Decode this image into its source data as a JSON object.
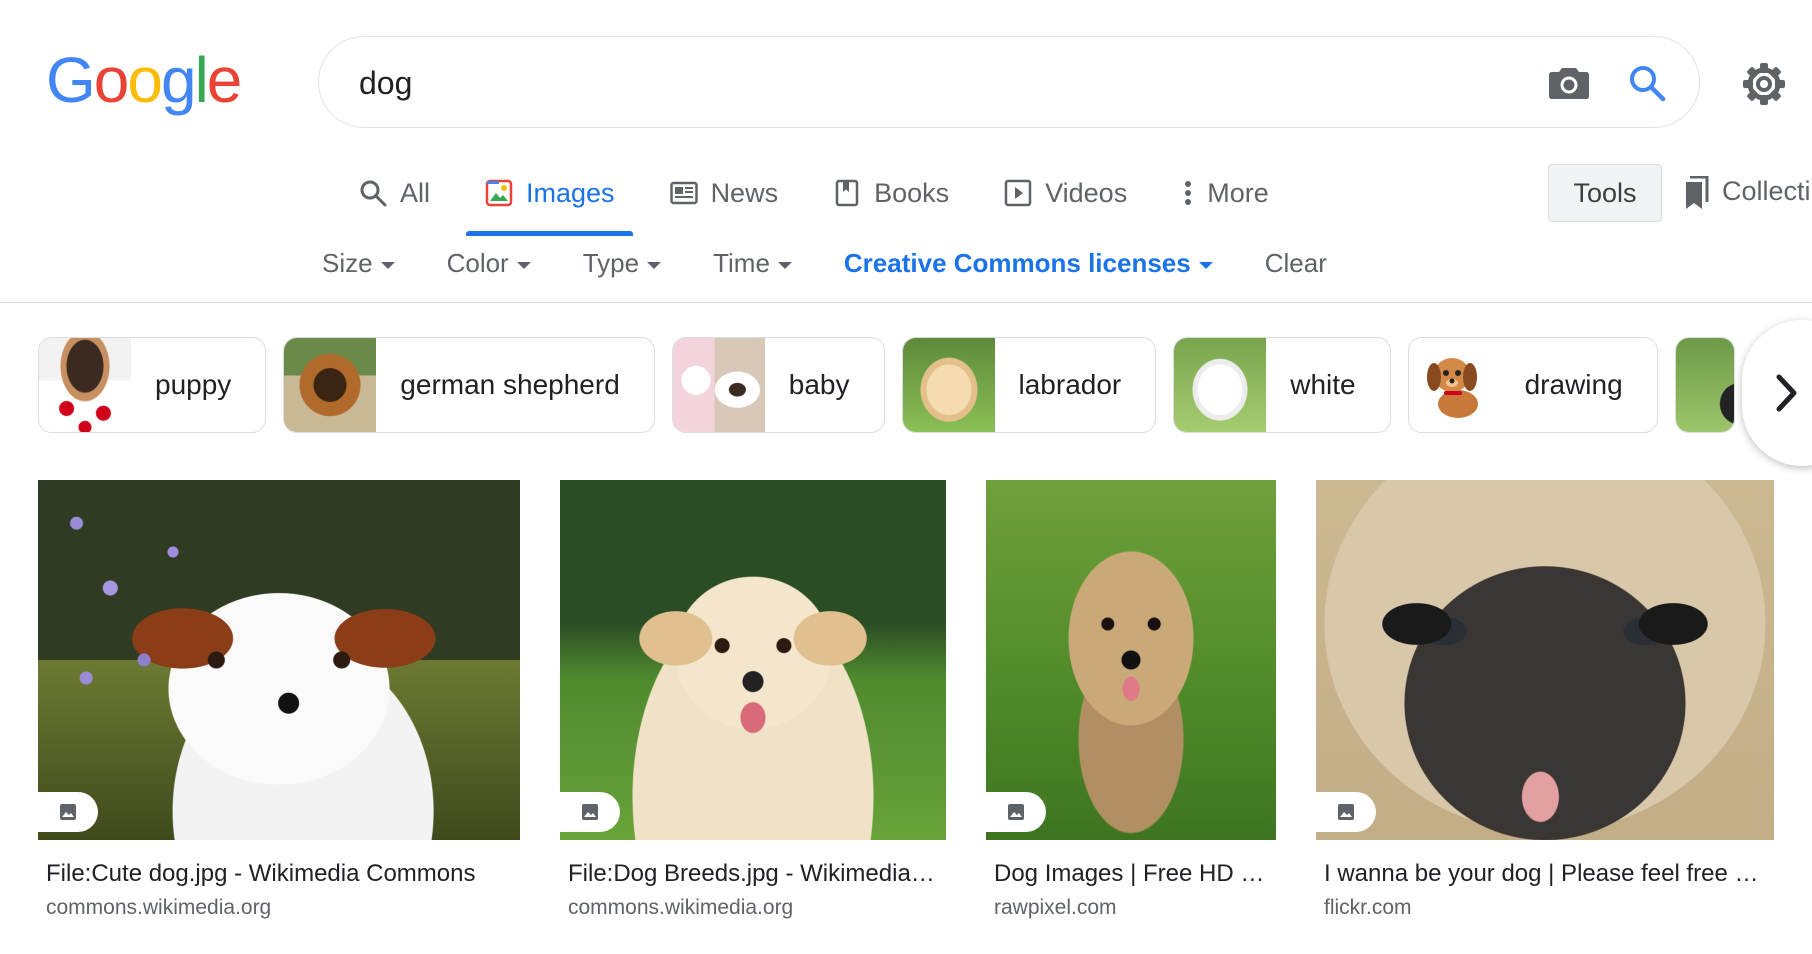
{
  "logo": {
    "letters": [
      "G",
      "o",
      "o",
      "g",
      "l",
      "e"
    ],
    "colors": [
      "#4285F4",
      "#EA4335",
      "#FBBC05",
      "#4285F4",
      "#34A853",
      "#EA4335"
    ]
  },
  "search": {
    "query": "dog"
  },
  "icons": {
    "camera": "camera-icon",
    "search": "search-icon",
    "settings": "gear-icon"
  },
  "tabs": [
    {
      "label": "All",
      "icon": "search-icon",
      "active": false
    },
    {
      "label": "Images",
      "icon": "image-icon",
      "active": true
    },
    {
      "label": "News",
      "icon": "newspaper-icon",
      "active": false
    },
    {
      "label": "Books",
      "icon": "book-icon",
      "active": false
    },
    {
      "label": "Videos",
      "icon": "play-icon",
      "active": false
    },
    {
      "label": "More",
      "icon": "more-vert-icon",
      "active": false
    }
  ],
  "tools": {
    "label": "Tools"
  },
  "collections": {
    "label": "Collecti"
  },
  "filters": [
    {
      "label": "Size"
    },
    {
      "label": "Color"
    },
    {
      "label": "Type"
    },
    {
      "label": "Time"
    },
    {
      "label": "Creative Commons licenses"
    },
    {
      "label": "Clear"
    }
  ],
  "chips": [
    {
      "label": "puppy"
    },
    {
      "label": "german shepherd"
    },
    {
      "label": "baby"
    },
    {
      "label": "labrador"
    },
    {
      "label": "white"
    },
    {
      "label": "drawing"
    }
  ],
  "results": [
    {
      "title": "File:Cute dog.jpg - Wikimedia Commons",
      "site": "commons.wikimedia.org"
    },
    {
      "title": "File:Dog Breeds.jpg - Wikimedia…",
      "site": "commons.wikimedia.org"
    },
    {
      "title": "Dog Images | Free HD …",
      "site": "rawpixel.com"
    },
    {
      "title": "I wanna be your dog | Please feel free …",
      "site": "flickr.com"
    }
  ],
  "colors": {
    "accent": "#1a73e8",
    "text": "#202124",
    "muted": "#5f6368",
    "border": "#dadce0"
  }
}
